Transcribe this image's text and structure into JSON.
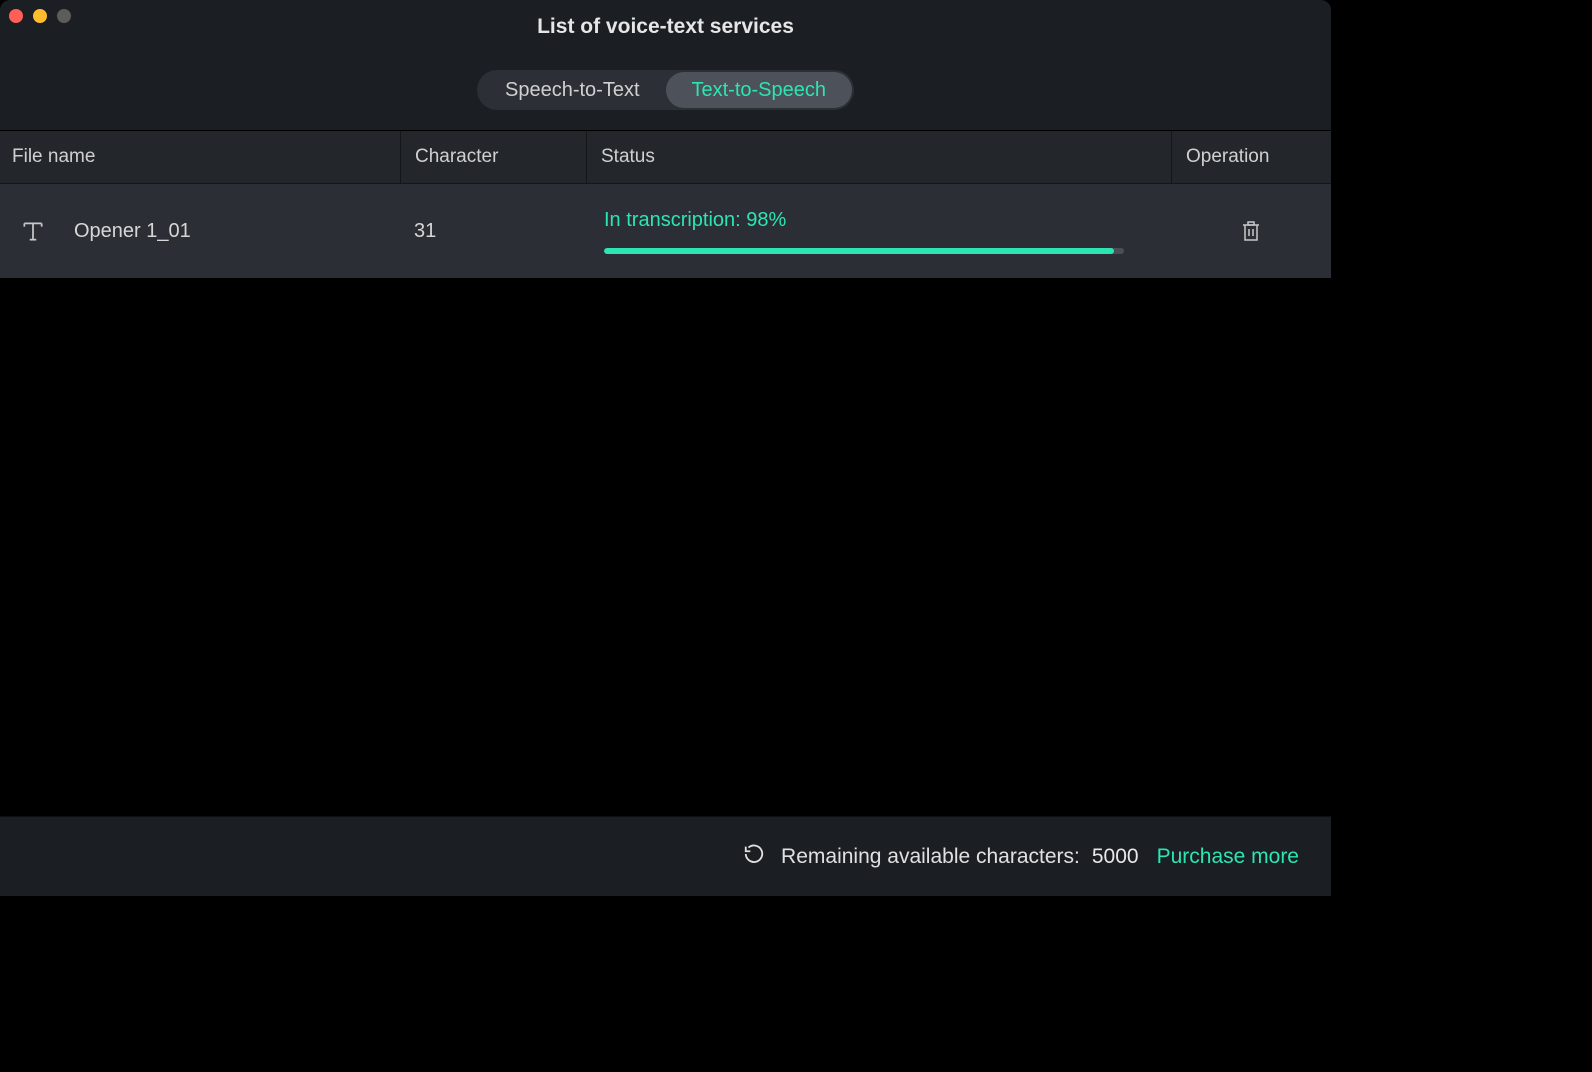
{
  "window": {
    "title": "List of voice-text services"
  },
  "tabs": {
    "speech_to_text": "Speech-to-Text",
    "text_to_speech": "Text-to-Speech"
  },
  "columns": {
    "file_name": "File name",
    "character": "Character",
    "status": "Status",
    "operation": "Operation"
  },
  "rows": [
    {
      "file_name": "Opener 1_01",
      "character": "31",
      "status_text": "In transcription: 98%",
      "progress_percent": 98
    }
  ],
  "footer": {
    "label": "Remaining available characters:",
    "count": "5000",
    "purchase_link": "Purchase more"
  }
}
